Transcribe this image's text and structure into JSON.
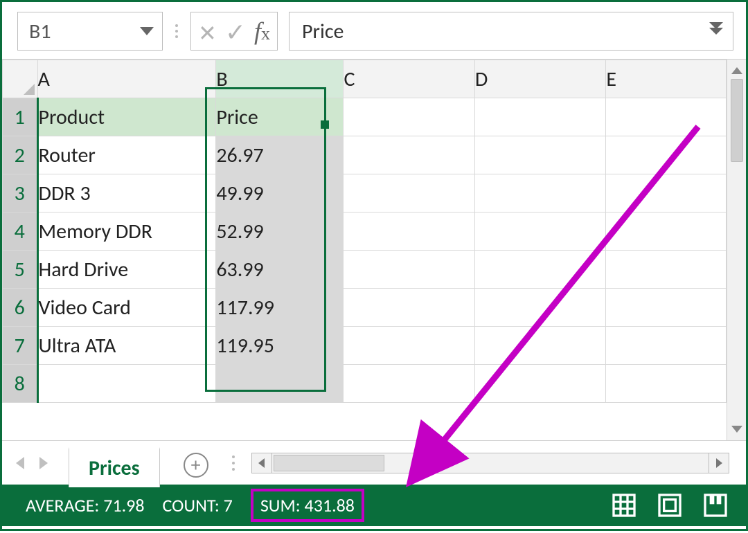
{
  "namebox": {
    "value": "B1"
  },
  "formula": {
    "value": "Price"
  },
  "columns": [
    "A",
    "B",
    "C",
    "D",
    "E"
  ],
  "rows": [
    "1",
    "2",
    "3",
    "4",
    "5",
    "6",
    "7",
    "8"
  ],
  "cells": {
    "A1": "Product",
    "B1": "Price",
    "A2": "Router",
    "B2": "26.97",
    "A3": "DDR 3",
    "B3": "49.99",
    "A4": "Memory DDR",
    "B4": "52.99",
    "A5": "Hard Drive",
    "B5": "63.99",
    "A6": "Video Card",
    "B6": "117.99",
    "A7": "Ultra ATA",
    "B7": "119.95"
  },
  "sheetTab": "Prices",
  "status": {
    "averageLabel": "AVERAGE: 71.98",
    "countLabel": "COUNT: 7",
    "sumLabel": "SUM: 431.88"
  },
  "chart_data": {
    "type": "table",
    "title": "Prices",
    "columns": [
      "Product",
      "Price"
    ],
    "rows": [
      [
        "Router",
        26.97
      ],
      [
        "DDR 3",
        49.99
      ],
      [
        "Memory DDR",
        52.99
      ],
      [
        "Hard Drive",
        63.99
      ],
      [
        "Video Card",
        117.99
      ],
      [
        "Ultra ATA",
        119.95
      ]
    ],
    "aggregates": {
      "average": 71.98,
      "count": 7,
      "sum": 431.88
    }
  }
}
